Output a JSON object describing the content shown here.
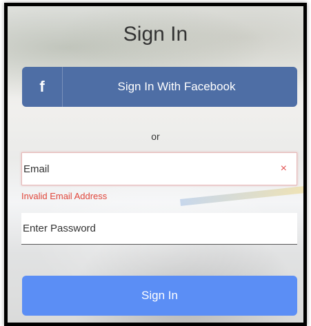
{
  "title": "Sign In",
  "facebook": {
    "icon": "f",
    "label": "Sign In With Facebook"
  },
  "divider": "or",
  "email": {
    "placeholder": "Email",
    "value": "",
    "clear_icon": "×",
    "error": "Invalid Email Address"
  },
  "password": {
    "placeholder": "Enter Password",
    "value": ""
  },
  "signin": {
    "label": "Sign In"
  },
  "colors": {
    "facebook": "#4e6ea5",
    "primary": "#5b8ef5",
    "error": "#e0463b"
  }
}
